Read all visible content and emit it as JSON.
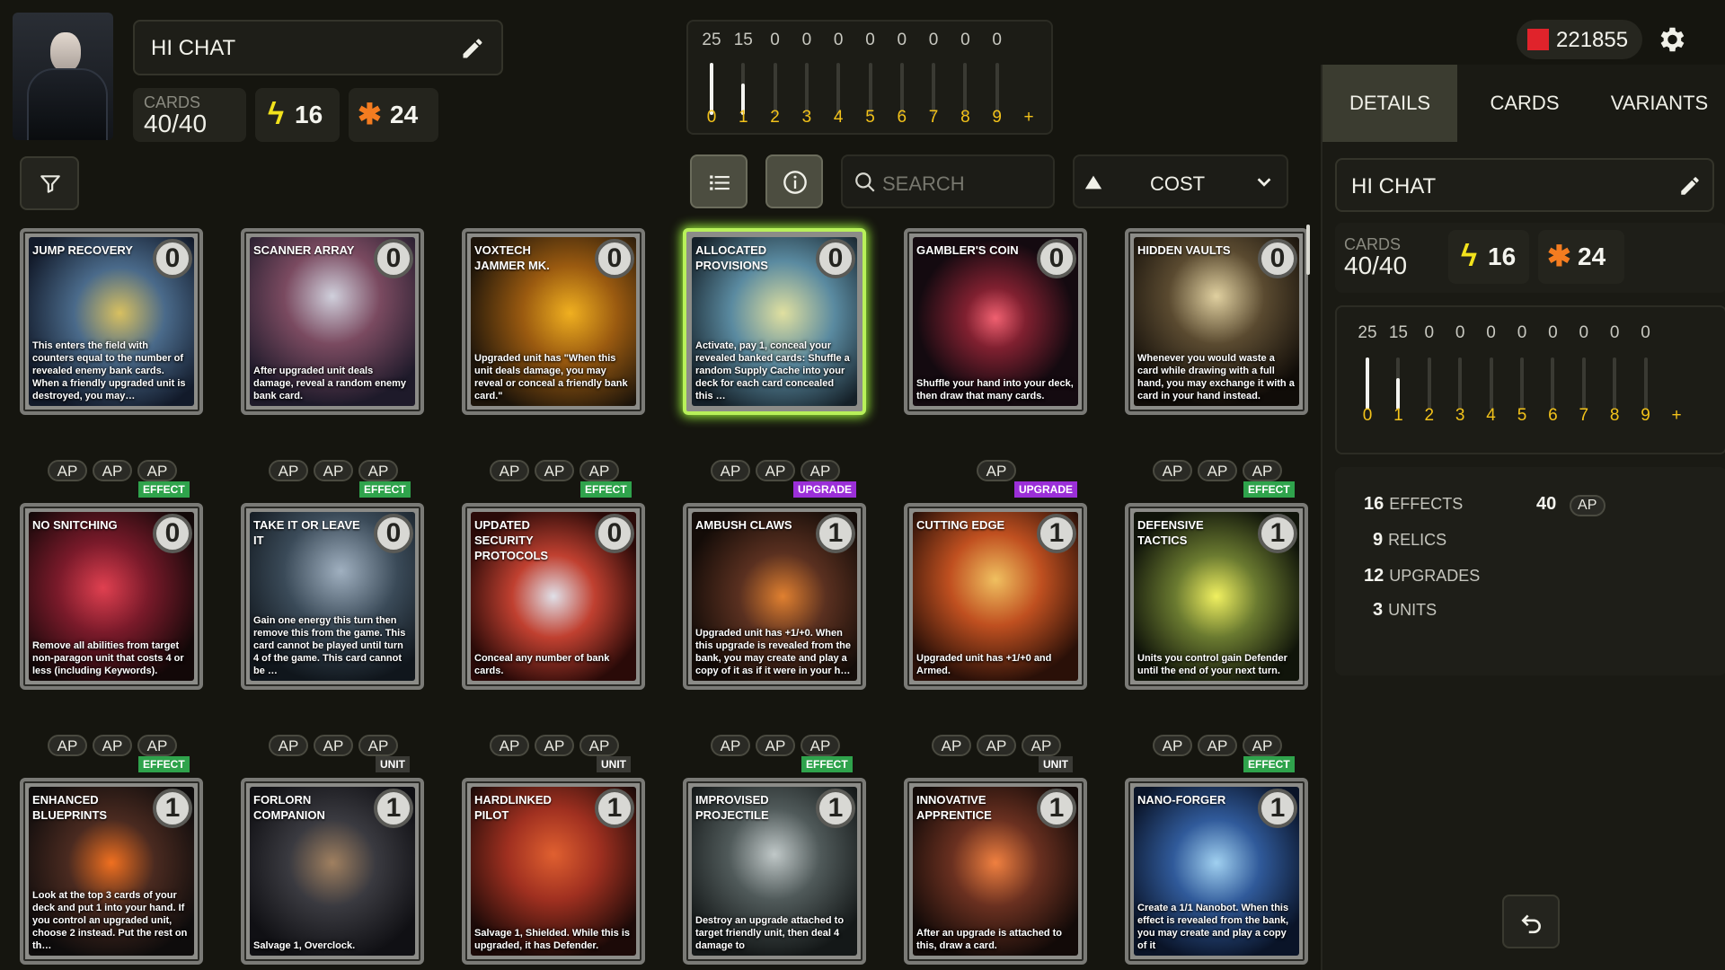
{
  "profile": {
    "deck_name": "HI CHAT",
    "cards_label": "CARDS",
    "cards_value": "40/40",
    "energy": "16",
    "power": "24"
  },
  "currency": {
    "value": "221855",
    "icon": "gem-icon"
  },
  "cost_curve": {
    "counts": [
      "25",
      "15",
      "0",
      "0",
      "0",
      "0",
      "0",
      "0",
      "0",
      "0"
    ],
    "costs": [
      "0",
      "1",
      "2",
      "3",
      "4",
      "5",
      "6",
      "7",
      "8",
      "9",
      "+"
    ],
    "fill": [
      1.0,
      0.6,
      0,
      0,
      0,
      0,
      0,
      0,
      0,
      0,
      0
    ]
  },
  "toolbar": {
    "search_placeholder": "SEARCH",
    "sort_label": "COST"
  },
  "cards": [
    {
      "title": "JUMP RECOVERY",
      "cost": "0",
      "text": "This enters the field with counters equal to the number of revealed enemy bank cards. When a friendly upgraded unit is destroyed, you may…",
      "ap": [
        "AP",
        "AP",
        "AP"
      ],
      "tag": "EFFECT"
    },
    {
      "title": "SCANNER ARRAY",
      "cost": "0",
      "text": "After upgraded unit deals damage, reveal a random enemy bank card.",
      "ap": [
        "AP",
        "AP",
        "AP"
      ],
      "tag": "EFFECT"
    },
    {
      "title": "VOXTECH JAMMER MK.",
      "cost": "0",
      "text": "Upgraded unit has \"When this unit deals damage, you may reveal or conceal a friendly bank card.\"",
      "ap": [
        "AP",
        "AP",
        "AP"
      ],
      "tag": "EFFECT"
    },
    {
      "title": "ALLOCATED PROVISIONS",
      "cost": "0",
      "text": "Activate, pay 1, conceal your revealed banked cards: Shuffle a random Supply Cache into your deck for each card concealed this …",
      "ap": [
        "AP",
        "AP",
        "AP"
      ],
      "tag": "UPGRADE"
    },
    {
      "title": "GAMBLER'S COIN",
      "cost": "0",
      "text": "Shuffle your hand into your deck, then draw that many cards.",
      "ap": [
        "AP"
      ],
      "tag": "UPGRADE"
    },
    {
      "title": "HIDDEN VAULTS",
      "cost": "0",
      "text": "Whenever you would waste a card while drawing with a full hand, you may exchange it with a card in your hand instead.",
      "ap": [
        "AP",
        "AP",
        "AP"
      ],
      "tag": "EFFECT"
    },
    {
      "title": "NO SNITCHING",
      "cost": "0",
      "text": "Remove all abilities from target non-paragon unit that costs 4 or less (including Keywords).",
      "ap": [
        "AP",
        "AP",
        "AP"
      ],
      "tag": "EFFECT"
    },
    {
      "title": "TAKE IT OR LEAVE IT",
      "cost": "0",
      "text": "Gain one energy this turn then remove this from the game. This card cannot be played until turn 4 of the game. This card cannot be …",
      "ap": [
        "AP",
        "AP",
        "AP"
      ],
      "tag": "UNIT"
    },
    {
      "title": "UPDATED SECURITY PROTOCOLS",
      "cost": "0",
      "text": "Conceal any number of bank cards.",
      "ap": [
        "AP",
        "AP",
        "AP"
      ],
      "tag": "UNIT"
    },
    {
      "title": "AMBUSH CLAWS",
      "cost": "1",
      "text": "Upgraded unit has +1/+0. When this upgrade is revealed from the bank, you may create and play a copy of it as if it were in your h…",
      "ap": [
        "AP",
        "AP",
        "AP"
      ],
      "tag": "EFFECT"
    },
    {
      "title": "CUTTING EDGE",
      "cost": "1",
      "text": "Upgraded unit has +1/+0 and Armed.",
      "ap": [
        "AP",
        "AP",
        "AP"
      ],
      "tag": "UNIT"
    },
    {
      "title": "DEFENSIVE TACTICS",
      "cost": "1",
      "text": "Units you control gain Defender until the end of your next turn.",
      "ap": [
        "AP",
        "AP",
        "AP"
      ],
      "tag": "EFFECT"
    },
    {
      "title": "ENHANCED BLUEPRINTS",
      "cost": "1",
      "text": "Look at the top 3 cards of your deck and put 1 into your hand. If you control an upgraded unit, choose 2 instead. Put the rest on th…",
      "ap": [],
      "tag": ""
    },
    {
      "title": "FORLORN COMPANION",
      "cost": "1",
      "text": "Salvage 1, Overclock.",
      "ap": [],
      "tag": ""
    },
    {
      "title": "HARDLINKED PILOT",
      "cost": "1",
      "text": "Salvage 1, Shielded. While this is upgraded, it has Defender.",
      "ap": [],
      "tag": ""
    },
    {
      "title": "IMPROVISED PROJECTILE",
      "cost": "1",
      "text": "Destroy an upgrade attached to target friendly unit, then deal 4 damage to",
      "ap": [],
      "tag": ""
    },
    {
      "title": "INNOVATIVE APPRENTICE",
      "cost": "1",
      "text": "After an upgrade is attached to this, draw a card.",
      "ap": [],
      "tag": ""
    },
    {
      "title": "NANO-FORGER",
      "cost": "1",
      "text": "Create a 1/1 Nanobot. When this effect is revealed from the bank, you may create and play a copy of it",
      "ap": [],
      "tag": ""
    }
  ],
  "right_panel": {
    "tabs": [
      "DETAILS",
      "CARDS",
      "VARIANTS"
    ],
    "deck_name": "HI CHAT",
    "cards_label": "CARDS",
    "cards_value": "40/40",
    "energy": "16",
    "power": "24",
    "curve_counts": [
      "25",
      "15",
      "0",
      "0",
      "0",
      "0",
      "0",
      "0",
      "0",
      "0"
    ],
    "breakdown": [
      {
        "num": "16",
        "label": "EFFECTS"
      },
      {
        "num": "9",
        "label": "RELICS"
      },
      {
        "num": "12",
        "label": "UPGRADES"
      },
      {
        "num": "3",
        "label": "UNITS"
      }
    ],
    "ap_total": "40",
    "ap_label": "AP"
  },
  "colors": {
    "energy": "#f2e21c",
    "power": "#f47c20",
    "curve_cost": "#f2c21a",
    "effect_tag": "#2fa34c",
    "upgrade_tag": "#9b2fd8"
  }
}
